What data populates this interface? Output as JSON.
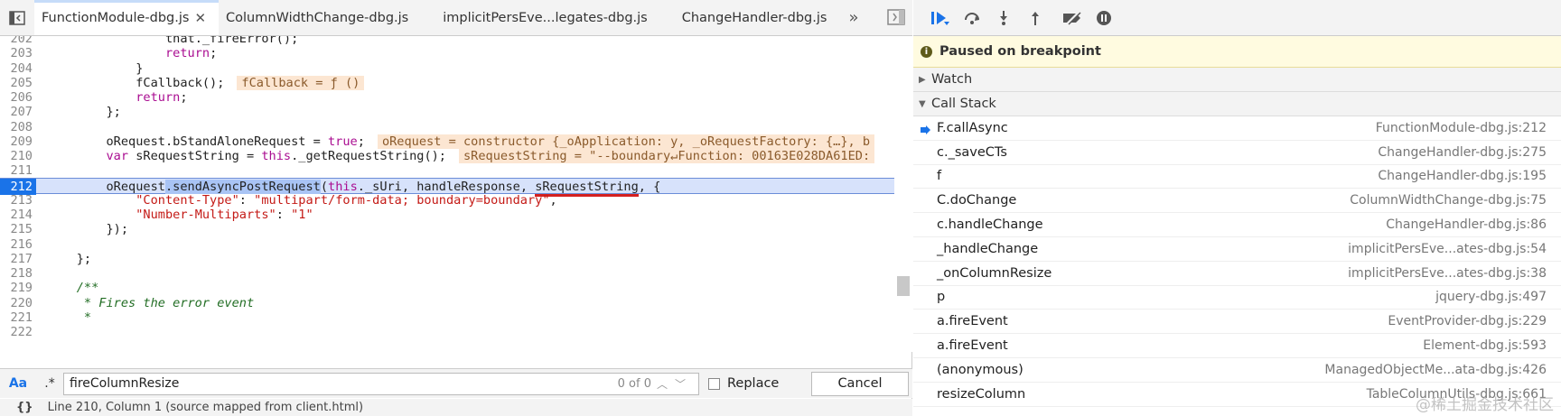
{
  "tabs": [
    {
      "label": "FunctionModule-dbg.js",
      "active": true,
      "closable": true
    },
    {
      "label": "ColumnWidthChange-dbg.js"
    },
    {
      "label": "implicitPersEve...legates-dbg.js"
    },
    {
      "label": "ChangeHandler-dbg.js"
    }
  ],
  "code": {
    "lines": [
      {
        "n": "202",
        "html": "<span class=\"cm\"></span>                <span>that._fireError();</span>"
      },
      {
        "n": "203",
        "html": "                <span class=\"kw\">return</span>;"
      },
      {
        "n": "204",
        "html": "            }"
      },
      {
        "n": "205",
        "html": "            fCallback();<span class=\"inl\">fCallback = ƒ ()</span>"
      },
      {
        "n": "206",
        "html": "            <span class=\"kw\">return</span>;"
      },
      {
        "n": "207",
        "html": "        };"
      },
      {
        "n": "208",
        "html": ""
      },
      {
        "n": "209",
        "html": "        oRequest.bStandAloneRequest = <span class=\"kw\">true</span>;<span class=\"inl\">oRequest = constructor {_oApplication: y, _oRequestFactory: {…}, b</span>"
      },
      {
        "n": "210",
        "html": "        <span class=\"kw\">var</span> sRequestString = <span class=\"kw\">this</span>._getRequestString();<span class=\"inl\">sRequestString = \"--boundary↵Function: 00163E028DA61ED:</span>"
      },
      {
        "n": "211",
        "html": ""
      },
      {
        "n": "212",
        "html": "        oRequest<span class=\"hl\">.sendAsyncPostRequest</span>(<span class=\"kw\">this</span>._sUri, handleResponse, <span class=\"underl\">sRequestString</span>, {",
        "exec": true
      },
      {
        "n": "213",
        "html": "            <span class=\"str\">\"Content-Type\"</span>: <span class=\"str\">\"multipart/form-data; boundary=boundary\"</span>,"
      },
      {
        "n": "214",
        "html": "            <span class=\"str\">\"Number-Multiparts\"</span>: <span class=\"str\">\"1\"</span>"
      },
      {
        "n": "215",
        "html": "        });"
      },
      {
        "n": "216",
        "html": ""
      },
      {
        "n": "217",
        "html": "    };"
      },
      {
        "n": "218",
        "html": ""
      },
      {
        "n": "219",
        "html": "    <span class=\"cm\">/**</span>"
      },
      {
        "n": "220",
        "html": "<span class=\"cm\">     * Fires the error event</span>"
      },
      {
        "n": "221",
        "html": "<span class=\"cm\">     *</span>"
      },
      {
        "n": "222",
        "html": ""
      }
    ]
  },
  "search": {
    "aa_label": "Aa",
    "regex_label": ".*",
    "value": "fireColumnResize",
    "count": "0 of 0",
    "replace_label": "Replace",
    "cancel_label": "Cancel"
  },
  "status": {
    "brace": "{}",
    "text": "Line 210, Column 1    (source mapped from client.html)"
  },
  "debugger": {
    "paused_label": "Paused on breakpoint",
    "watch_label": "Watch",
    "callstack_label": "Call Stack",
    "frames": [
      {
        "fn": "F.callAsync",
        "loc": "FunctionModule-dbg.js:212",
        "current": true
      },
      {
        "fn": "c._saveCTs",
        "loc": "ChangeHandler-dbg.js:275"
      },
      {
        "fn": "f",
        "loc": "ChangeHandler-dbg.js:195"
      },
      {
        "fn": "C.doChange",
        "loc": "ColumnWidthChange-dbg.js:75"
      },
      {
        "fn": "c.handleChange",
        "loc": "ChangeHandler-dbg.js:86"
      },
      {
        "fn": "_handleChange",
        "loc": "implicitPersEve...ates-dbg.js:54"
      },
      {
        "fn": "_onColumnResize",
        "loc": "implicitPersEve...ates-dbg.js:38"
      },
      {
        "fn": "p",
        "loc": "jquery-dbg.js:497"
      },
      {
        "fn": "a.fireEvent",
        "loc": "EventProvider-dbg.js:229"
      },
      {
        "fn": "a.fireEvent",
        "loc": "Element-dbg.js:593"
      },
      {
        "fn": "(anonymous)",
        "loc": "ManagedObjectMe...ata-dbg.js:426"
      },
      {
        "fn": "resizeColumn",
        "loc": "TableColumnUtils-dbg.js:661"
      }
    ]
  },
  "watermark": "@稀土掘金技术社区",
  "colors": {
    "accent": "#1a73e8",
    "exec_line": "#d7e2fb",
    "paused_bg": "#fffbe0",
    "inline_value_bg": "#fce6d2"
  }
}
